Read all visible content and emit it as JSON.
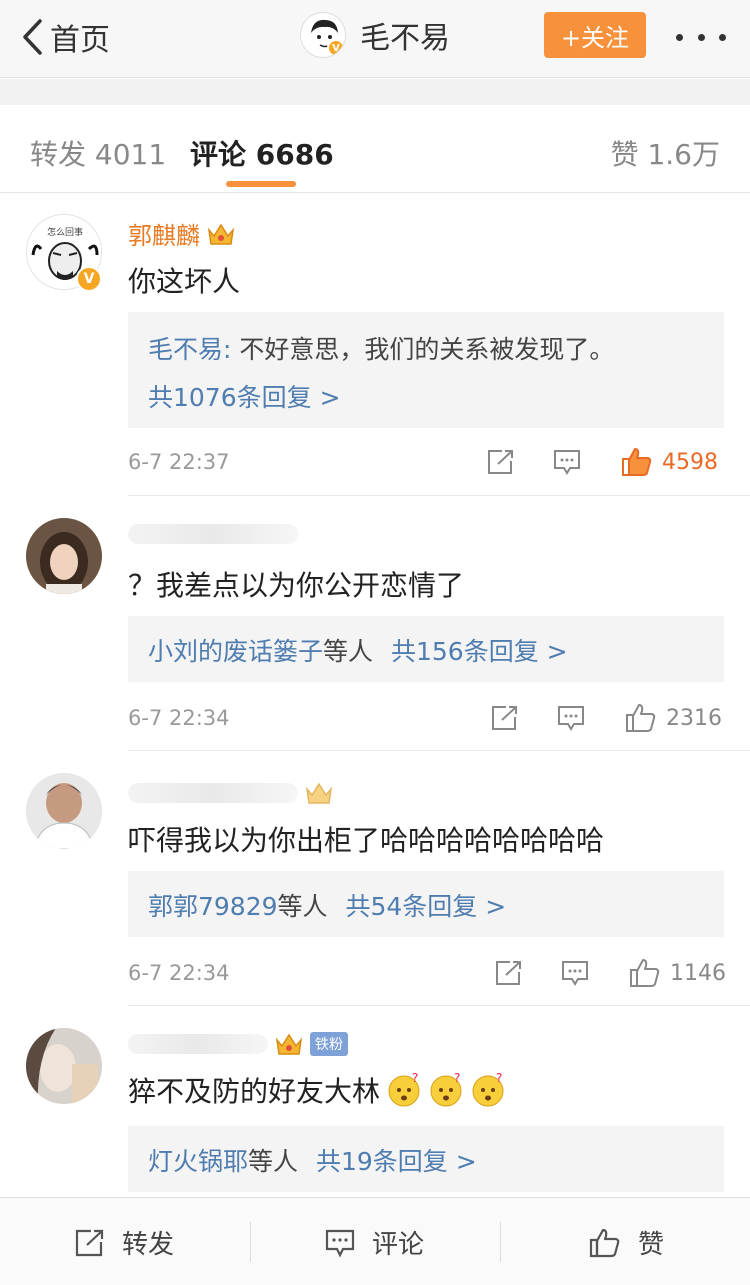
{
  "topbar": {
    "back_label": "首页",
    "user_name": "毛不易",
    "follow_label": "+关注"
  },
  "tabs": {
    "repost": "转发 4011",
    "comment": "评论 6686",
    "like": "赞 1.6万"
  },
  "comments": [
    {
      "name": "郭麒麟",
      "text": "你这坏人",
      "reply_author": "毛不易:",
      "reply_text": " 不好意思，我们的关系被发现了。",
      "reply_count": "共1076条回复 >",
      "time": "6-7 22:37",
      "likes": "4598"
    },
    {
      "name": "",
      "text": "？我差点以为你公开恋情了",
      "reply_people": "小刘的废话篓子",
      "reply_suffix": "等人",
      "reply_total": "共156条回复 >",
      "time": "6-7 22:34",
      "likes": "2316"
    },
    {
      "name": "",
      "text": "吓得我以为你出柜了哈哈哈哈哈哈哈哈",
      "reply_people": "郭郭79829",
      "reply_suffix": "等人",
      "reply_total": "共54条回复 >",
      "time": "6-7 22:34",
      "likes": "1146"
    },
    {
      "name": "",
      "badge": "铁粉",
      "text": "猝不及防的好友大林",
      "reply_people": "灯火锅耶",
      "reply_suffix": "等人",
      "reply_total": "共19条回复 >"
    }
  ],
  "bottom": {
    "repost": "转发",
    "comment": "评论",
    "like": "赞"
  },
  "colors": {
    "accent": "#f7913b",
    "link": "#4f7db0",
    "name": "#e87a22"
  }
}
